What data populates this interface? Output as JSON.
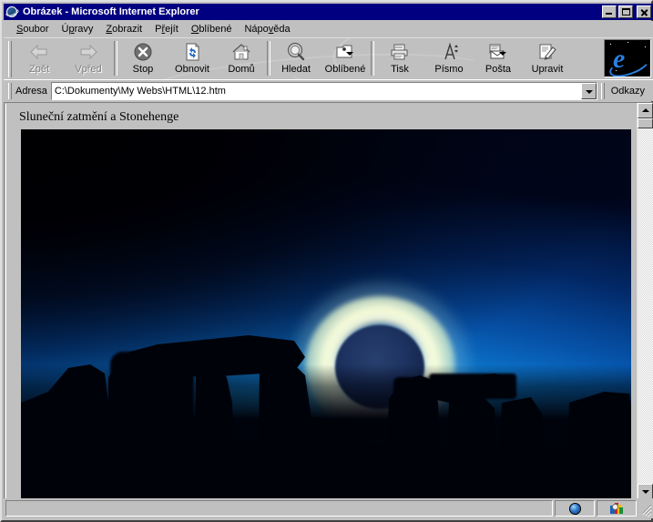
{
  "window": {
    "title": "Obrázek - Microsoft Internet Explorer",
    "title_icon": "ie-globe-icon",
    "minimize_label": "_",
    "maximize_label": "□",
    "close_label": "✕"
  },
  "menu": {
    "items": [
      {
        "name": "soubor",
        "pre": "S",
        "accel": "",
        "text_before": "",
        "label": "Soubor",
        "acc_index": 0
      },
      {
        "name": "upravy",
        "label": "Úpravy",
        "acc_index": 2
      },
      {
        "name": "zobrazit",
        "label": "Zobrazit",
        "acc_index": 0
      },
      {
        "name": "prejit",
        "label": "Přejít",
        "acc_index": 1
      },
      {
        "name": "oblibene",
        "label": "Oblíbené",
        "acc_index": 0
      },
      {
        "name": "napoveda",
        "label": "Nápověda",
        "acc_index": 4
      }
    ]
  },
  "toolbar": {
    "buttons": [
      {
        "name": "back",
        "label": "Zpět",
        "icon": "arrow-left-icon",
        "disabled": true,
        "dropdown": false
      },
      {
        "name": "forward",
        "label": "Vpřed",
        "icon": "arrow-right-icon",
        "disabled": true,
        "dropdown": false
      },
      {
        "name": "stop",
        "label": "Stop",
        "icon": "stop-icon",
        "disabled": false,
        "dropdown": false
      },
      {
        "name": "refresh",
        "label": "Obnovit",
        "icon": "refresh-icon",
        "disabled": false,
        "dropdown": false
      },
      {
        "name": "home",
        "label": "Domů",
        "icon": "home-icon",
        "disabled": false,
        "dropdown": false
      },
      {
        "name": "search",
        "label": "Hledat",
        "icon": "search-icon",
        "disabled": false,
        "dropdown": false
      },
      {
        "name": "favorites",
        "label": "Oblíbené",
        "icon": "favorites-icon",
        "disabled": false,
        "dropdown": true
      },
      {
        "name": "print",
        "label": "Tisk",
        "icon": "printer-icon",
        "disabled": false,
        "dropdown": false
      },
      {
        "name": "font",
        "label": "Písmo",
        "icon": "font-size-icon",
        "disabled": false,
        "dropdown": false
      },
      {
        "name": "mail",
        "label": "Pošta",
        "icon": "mail-icon",
        "disabled": false,
        "dropdown": true
      },
      {
        "name": "edit",
        "label": "Upravit",
        "icon": "edit-pencil-icon",
        "disabled": false,
        "dropdown": false
      }
    ],
    "logo_letter": "e",
    "logo_name": "ie-animated-logo"
  },
  "address": {
    "label": "Adresa",
    "value": "C:\\Dokumenty\\My Webs\\HTML\\12.htm",
    "placeholder": "",
    "dropdown_icon": "chevron-down-icon",
    "links_label": "Odkazy"
  },
  "document": {
    "heading": "Sluneční zatmění a Stonehenge",
    "image_alt": "Sluneční zatmění nad Stonehenge",
    "image_name": "eclipse-stonehenge-photo"
  },
  "scrollbar": {
    "up_icon": "scroll-up-arrow-icon",
    "down_icon": "scroll-down-arrow-icon",
    "thumb_name": "scroll-thumb"
  },
  "statusbar": {
    "message": "",
    "zone_icon": "internet-zone-globe-icon",
    "zone_text": "",
    "second_icon": "ie-colors-icon"
  },
  "colors": {
    "titlebar": "#000080",
    "face": "#c0c0c0",
    "shadow": "#808080",
    "highlight": "#ffffff",
    "photo_sky_top": "#000006",
    "photo_sky_mid": "#0e6fc0",
    "photo_horizon": "#ffe9b4",
    "corona": "#fafde0",
    "moon": "#1d3260"
  }
}
